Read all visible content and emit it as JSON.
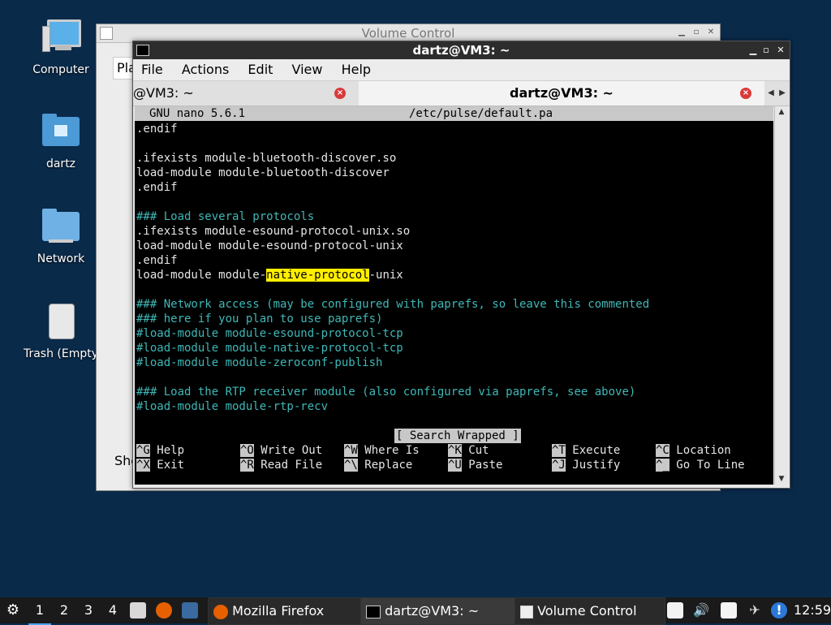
{
  "desktop": {
    "icons": [
      {
        "label": "Computer",
        "icon": "computer-icon"
      },
      {
        "label": "dartz",
        "icon": "home-folder-icon"
      },
      {
        "label": "Network",
        "icon": "network-folder-icon"
      },
      {
        "label": "Trash (Empty",
        "icon": "trash-icon"
      }
    ]
  },
  "volume_window": {
    "title": "Volume Control",
    "tab_partial": "Pla",
    "side_partial": "Sho"
  },
  "terminal_window": {
    "title": "dartz@VM3: ~",
    "menu": [
      "File",
      "Actions",
      "Edit",
      "View",
      "Help"
    ],
    "tabs": [
      {
        "label": "@VM3: ~"
      },
      {
        "label": "dartz@VM3: ~"
      }
    ],
    "nano": {
      "version": "GNU nano 5.6.1",
      "file": "/etc/pulse/default.pa",
      "line_1": ".endif",
      "line_2": "",
      "line_3": ".ifexists module-bluetooth-discover.so",
      "line_4": "load-module module-bluetooth-discover",
      "line_5": ".endif",
      "line_6": "",
      "line_7": "### Load several protocols",
      "line_8": ".ifexists module-esound-protocol-unix.so",
      "line_9": "load-module module-esound-protocol-unix",
      "line_10": ".endif",
      "line_11_prefix": "load-module module-",
      "line_11_match": "native-protocol",
      "line_11_suffix": "-unix",
      "line_12": "",
      "line_13": "### Network access (may be configured with paprefs, so leave this commented",
      "line_14": "### here if you plan to use paprefs)",
      "line_15": "#load-module module-esound-protocol-tcp",
      "line_16": "#load-module module-native-protocol-tcp",
      "line_17": "#load-module module-zeroconf-publish",
      "line_18": "",
      "line_19": "### Load the RTP receiver module (also configured via paprefs, see above)",
      "line_20": "#load-module module-rtp-recv",
      "status": "[ Search Wrapped ]",
      "shortcuts": [
        {
          "key": "^G",
          "label": "Help"
        },
        {
          "key": "^O",
          "label": "Write Out"
        },
        {
          "key": "^W",
          "label": "Where Is"
        },
        {
          "key": "^K",
          "label": "Cut"
        },
        {
          "key": "^T",
          "label": "Execute"
        },
        {
          "key": "^C",
          "label": "Location"
        },
        {
          "key": "^X",
          "label": "Exit"
        },
        {
          "key": "^R",
          "label": "Read File"
        },
        {
          "key": "^\\",
          "label": "Replace"
        },
        {
          "key": "^U",
          "label": "Paste"
        },
        {
          "key": "^J",
          "label": "Justify"
        },
        {
          "key": "^_",
          "label": "Go To Line"
        }
      ]
    }
  },
  "taskbar": {
    "workspaces": [
      "1",
      "2",
      "3",
      "4"
    ],
    "tasks": [
      {
        "label": "Mozilla Firefox"
      },
      {
        "label": "dartz@VM3: ~"
      },
      {
        "label": "Volume Control"
      }
    ],
    "clock": "12:59"
  }
}
